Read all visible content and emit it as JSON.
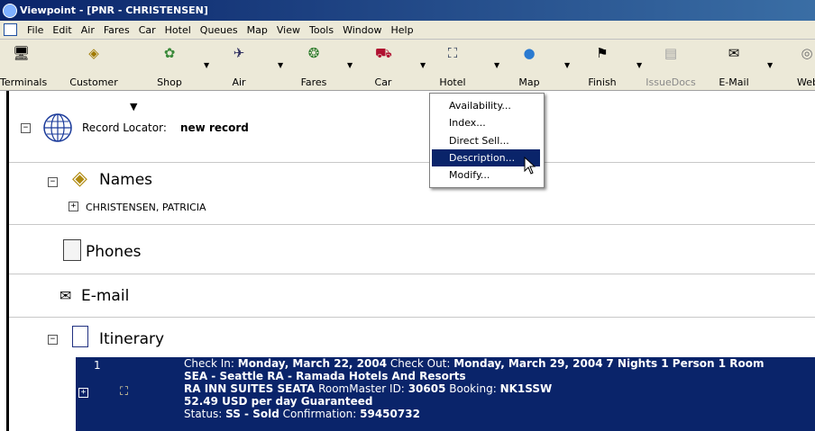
{
  "window": {
    "title": "Viewpoint - [PNR - CHRISTENSEN]"
  },
  "menubar": [
    "File",
    "Edit",
    "Air",
    "Fares",
    "Car",
    "Hotel",
    "Queues",
    "Map",
    "View",
    "Tools",
    "Window",
    "Help"
  ],
  "toolbar": {
    "terminals": "Terminals",
    "customer": "Customer",
    "shop": "Shop",
    "air": "Air",
    "fares": "Fares",
    "car": "Car",
    "hotel": "Hotel",
    "map": "Map",
    "finish": "Finish",
    "issuedocs": "IssueDocs",
    "email": "E-Mail",
    "web": "Web"
  },
  "hotel_menu": {
    "items": [
      "Availability...",
      "Index...",
      "Direct Sell...",
      "Description...",
      "Modify..."
    ],
    "selected": "Description..."
  },
  "record": {
    "label": "Record Locator:",
    "value": "new record"
  },
  "sections": {
    "names": "Names",
    "name_entry": "CHRISTENSEN, PATRICIA",
    "phones": "Phones",
    "email": "E-mail",
    "itinerary": "Itinerary"
  },
  "itinerary_item": {
    "number": "1",
    "checkin_label": "Check In:",
    "checkin_date": "Monday, March 22, 2004",
    "checkout_label": "Check Out:",
    "checkout_date": "Monday, March 29, 2004",
    "stay": "7 Nights 1 Person 1 Room",
    "location": "SEA - Seattle RA - Ramada Hotels And Resorts",
    "hotel_name": "RA INN SUITES SEATA",
    "roommaster_label": "RoomMaster ID:",
    "roommaster_id": "30605",
    "booking_label": "Booking:",
    "booking_code": "NK1SSW",
    "rate": "52.49 USD per day Guaranteed",
    "status_label": "Status:",
    "status_value": "SS - Sold",
    "confirmation_label": "Confirmation:",
    "confirmation_value": "59450732"
  }
}
